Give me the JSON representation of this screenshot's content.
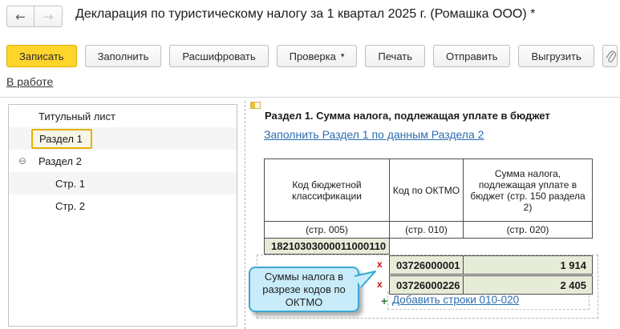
{
  "window": {
    "title": "Декларация по туристическому налогу за 1 квартал 2025 г. (Ромашка ООО) *"
  },
  "icons": {
    "back": "←",
    "forward": "→",
    "dropdown": "▾",
    "expander_open": "⊖",
    "delete": "x",
    "add": "+",
    "attachment": "paperclip"
  },
  "toolbar": {
    "save": "Записать",
    "fill": "Заполнить",
    "decipher": "Расшифровать",
    "check": "Проверка",
    "print": "Печать",
    "send": "Отправить",
    "export": "Выгрузить"
  },
  "status": {
    "label": "В работе"
  },
  "nav_tree": {
    "items": [
      {
        "label": "Титульный лист",
        "level": 1,
        "selected": false
      },
      {
        "label": "Раздел 1",
        "level": 1,
        "selected": true
      },
      {
        "label": "Раздел 2",
        "level": 1,
        "selected": false,
        "expanded": true
      },
      {
        "label": "Стр. 1",
        "level": 2,
        "selected": false
      },
      {
        "label": "Стр. 2",
        "level": 2,
        "selected": false
      }
    ]
  },
  "section": {
    "title": "Раздел 1. Сумма налога, подлежащая уплате в бюджет",
    "fill_link": "Заполнить Раздел 1 по данным Раздела 2",
    "table": {
      "columns": [
        {
          "header": "Код бюджетной классификации",
          "line_code": "(стр. 005)"
        },
        {
          "header": "Код по ОКТМО",
          "line_code": "(стр. 010)"
        },
        {
          "header": "Сумма налога, подлежащая уплате в бюджет (стр. 150 раздела 2)",
          "line_code": "(стр. 020)"
        }
      ],
      "kbk_value": "18210303000011000110",
      "rows": [
        {
          "oktmo": "03726000001",
          "amount": "1 914"
        },
        {
          "oktmo": "03726000226",
          "amount": "2 405"
        }
      ],
      "add_link": "Добавить строки 010-020"
    }
  },
  "callout": {
    "text": "Суммы налога в разрезе кодов по ОКТМО"
  },
  "colors": {
    "primary_button": "#ffd42b",
    "editable_cell": "#e7ecd9",
    "selected_outline": "#e2b200",
    "link": "#2b6cb0",
    "delete": "#cc1111",
    "add": "#2e7d32",
    "callout_bg": "#c9ecfa",
    "callout_border": "#3aa9d0"
  }
}
